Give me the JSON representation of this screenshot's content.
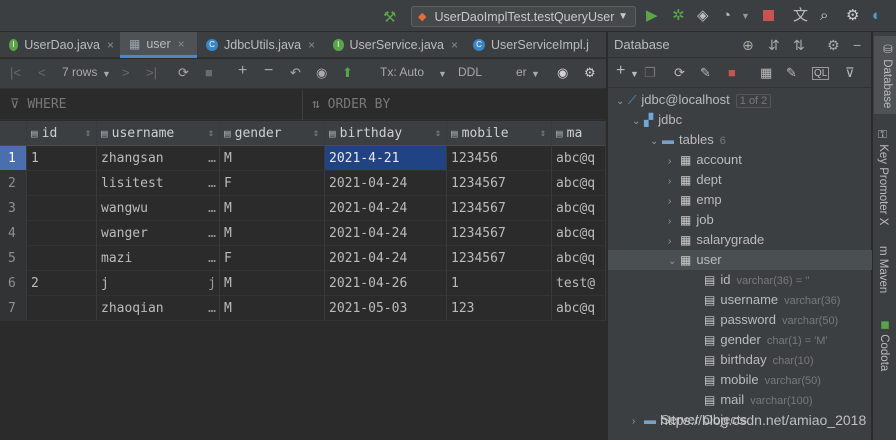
{
  "toolbar": {
    "run_config": "UserDaoImplTest.testQueryUser"
  },
  "tabs": [
    {
      "label": "UserDao.java",
      "icon": "interface-icon"
    },
    {
      "label": "user",
      "icon": "table-icon"
    },
    {
      "label": "JdbcUtils.java",
      "icon": "class-icon"
    },
    {
      "label": "UserService.java",
      "icon": "interface-icon"
    },
    {
      "label": "UserServiceImpl.j",
      "icon": "class-icon"
    }
  ],
  "grid_toolbar": {
    "rows": "7 rows",
    "tx": "Tx: Auto",
    "ddl": "DDL",
    "viewer": "er"
  },
  "filter": {
    "where": "WHERE",
    "order_by": "ORDER BY"
  },
  "columns": [
    "id",
    "username",
    "gender",
    "birthday",
    "mobile",
    "ma"
  ],
  "rows": [
    {
      "n": "1",
      "id": "1",
      "username": "zhangsan",
      "dots": "…",
      "gender": "M",
      "birthday": "2021-4-21",
      "mobile": "123456",
      "mail": "abc@q"
    },
    {
      "n": "2",
      "id": "",
      "username": "lisitest",
      "dots": "…",
      "gender": "F",
      "birthday": "2021-04-24",
      "mobile": "1234567",
      "mail": "abc@q"
    },
    {
      "n": "3",
      "id": "",
      "username": "wangwu",
      "dots": "…",
      "gender": "M",
      "birthday": "2021-04-24",
      "mobile": "1234567",
      "mail": "abc@q"
    },
    {
      "n": "4",
      "id": "",
      "username": "wanger",
      "dots": "…",
      "gender": "M",
      "birthday": "2021-04-24",
      "mobile": "1234567",
      "mail": "abc@q"
    },
    {
      "n": "5",
      "id": "",
      "username": "mazi",
      "dots": "…",
      "gender": "F",
      "birthday": "2021-04-24",
      "mobile": "1234567",
      "mail": "abc@q"
    },
    {
      "n": "6",
      "id": "2",
      "username": "j",
      "dots": "j",
      "gender": "M",
      "birthday": "2021-04-26",
      "mobile": "1",
      "mail": "test@"
    },
    {
      "n": "7",
      "id": "",
      "username": "zhaoqian",
      "dots": "…",
      "gender": "M",
      "birthday": "2021-05-03",
      "mobile": "123",
      "mail": "abc@q"
    }
  ],
  "database": {
    "title": "Database",
    "connection": "jdbc@localhost",
    "connection_badge": "1 of 2",
    "schema": "jdbc",
    "tables_label": "tables",
    "tables_count": "6",
    "tables": [
      "account",
      "dept",
      "emp",
      "job",
      "salarygrade",
      "user"
    ],
    "user_columns": [
      {
        "name": "id",
        "type": "varchar(36) = ''"
      },
      {
        "name": "username",
        "type": "varchar(36)"
      },
      {
        "name": "password",
        "type": "varchar(50)"
      },
      {
        "name": "gender",
        "type": "char(1) = 'M'"
      },
      {
        "name": "birthday",
        "type": "char(10)"
      },
      {
        "name": "mobile",
        "type": "varchar(50)"
      },
      {
        "name": "mail",
        "type": "varchar(100)"
      }
    ],
    "server_objects": "Server Objects"
  },
  "right_strip": [
    "Database",
    "Key Promoter X",
    "Maven",
    "Codota"
  ],
  "watermark": "https://blog.csdn.net/amiao_2018",
  "colors": {
    "accent": "#4a88c7",
    "selection": "#214283",
    "run": "#5aa54a",
    "stop": "#c75450"
  }
}
